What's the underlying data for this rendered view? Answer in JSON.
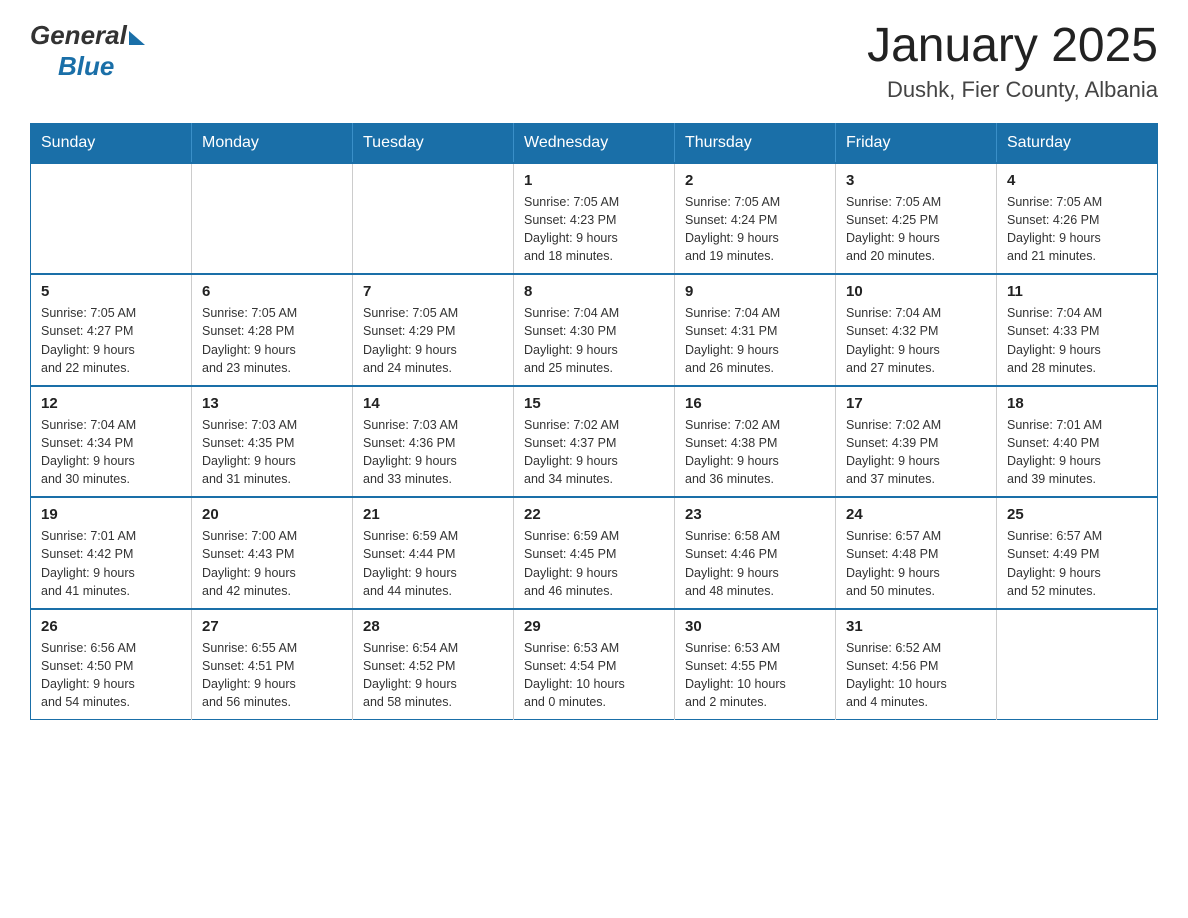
{
  "header": {
    "title": "January 2025",
    "location": "Dushk, Fier County, Albania",
    "logo_general": "General",
    "logo_blue": "Blue"
  },
  "calendar": {
    "days_of_week": [
      "Sunday",
      "Monday",
      "Tuesday",
      "Wednesday",
      "Thursday",
      "Friday",
      "Saturday"
    ],
    "weeks": [
      [
        {
          "day": "",
          "info": ""
        },
        {
          "day": "",
          "info": ""
        },
        {
          "day": "",
          "info": ""
        },
        {
          "day": "1",
          "info": "Sunrise: 7:05 AM\nSunset: 4:23 PM\nDaylight: 9 hours\nand 18 minutes."
        },
        {
          "day": "2",
          "info": "Sunrise: 7:05 AM\nSunset: 4:24 PM\nDaylight: 9 hours\nand 19 minutes."
        },
        {
          "day": "3",
          "info": "Sunrise: 7:05 AM\nSunset: 4:25 PM\nDaylight: 9 hours\nand 20 minutes."
        },
        {
          "day": "4",
          "info": "Sunrise: 7:05 AM\nSunset: 4:26 PM\nDaylight: 9 hours\nand 21 minutes."
        }
      ],
      [
        {
          "day": "5",
          "info": "Sunrise: 7:05 AM\nSunset: 4:27 PM\nDaylight: 9 hours\nand 22 minutes."
        },
        {
          "day": "6",
          "info": "Sunrise: 7:05 AM\nSunset: 4:28 PM\nDaylight: 9 hours\nand 23 minutes."
        },
        {
          "day": "7",
          "info": "Sunrise: 7:05 AM\nSunset: 4:29 PM\nDaylight: 9 hours\nand 24 minutes."
        },
        {
          "day": "8",
          "info": "Sunrise: 7:04 AM\nSunset: 4:30 PM\nDaylight: 9 hours\nand 25 minutes."
        },
        {
          "day": "9",
          "info": "Sunrise: 7:04 AM\nSunset: 4:31 PM\nDaylight: 9 hours\nand 26 minutes."
        },
        {
          "day": "10",
          "info": "Sunrise: 7:04 AM\nSunset: 4:32 PM\nDaylight: 9 hours\nand 27 minutes."
        },
        {
          "day": "11",
          "info": "Sunrise: 7:04 AM\nSunset: 4:33 PM\nDaylight: 9 hours\nand 28 minutes."
        }
      ],
      [
        {
          "day": "12",
          "info": "Sunrise: 7:04 AM\nSunset: 4:34 PM\nDaylight: 9 hours\nand 30 minutes."
        },
        {
          "day": "13",
          "info": "Sunrise: 7:03 AM\nSunset: 4:35 PM\nDaylight: 9 hours\nand 31 minutes."
        },
        {
          "day": "14",
          "info": "Sunrise: 7:03 AM\nSunset: 4:36 PM\nDaylight: 9 hours\nand 33 minutes."
        },
        {
          "day": "15",
          "info": "Sunrise: 7:02 AM\nSunset: 4:37 PM\nDaylight: 9 hours\nand 34 minutes."
        },
        {
          "day": "16",
          "info": "Sunrise: 7:02 AM\nSunset: 4:38 PM\nDaylight: 9 hours\nand 36 minutes."
        },
        {
          "day": "17",
          "info": "Sunrise: 7:02 AM\nSunset: 4:39 PM\nDaylight: 9 hours\nand 37 minutes."
        },
        {
          "day": "18",
          "info": "Sunrise: 7:01 AM\nSunset: 4:40 PM\nDaylight: 9 hours\nand 39 minutes."
        }
      ],
      [
        {
          "day": "19",
          "info": "Sunrise: 7:01 AM\nSunset: 4:42 PM\nDaylight: 9 hours\nand 41 minutes."
        },
        {
          "day": "20",
          "info": "Sunrise: 7:00 AM\nSunset: 4:43 PM\nDaylight: 9 hours\nand 42 minutes."
        },
        {
          "day": "21",
          "info": "Sunrise: 6:59 AM\nSunset: 4:44 PM\nDaylight: 9 hours\nand 44 minutes."
        },
        {
          "day": "22",
          "info": "Sunrise: 6:59 AM\nSunset: 4:45 PM\nDaylight: 9 hours\nand 46 minutes."
        },
        {
          "day": "23",
          "info": "Sunrise: 6:58 AM\nSunset: 4:46 PM\nDaylight: 9 hours\nand 48 minutes."
        },
        {
          "day": "24",
          "info": "Sunrise: 6:57 AM\nSunset: 4:48 PM\nDaylight: 9 hours\nand 50 minutes."
        },
        {
          "day": "25",
          "info": "Sunrise: 6:57 AM\nSunset: 4:49 PM\nDaylight: 9 hours\nand 52 minutes."
        }
      ],
      [
        {
          "day": "26",
          "info": "Sunrise: 6:56 AM\nSunset: 4:50 PM\nDaylight: 9 hours\nand 54 minutes."
        },
        {
          "day": "27",
          "info": "Sunrise: 6:55 AM\nSunset: 4:51 PM\nDaylight: 9 hours\nand 56 minutes."
        },
        {
          "day": "28",
          "info": "Sunrise: 6:54 AM\nSunset: 4:52 PM\nDaylight: 9 hours\nand 58 minutes."
        },
        {
          "day": "29",
          "info": "Sunrise: 6:53 AM\nSunset: 4:54 PM\nDaylight: 10 hours\nand 0 minutes."
        },
        {
          "day": "30",
          "info": "Sunrise: 6:53 AM\nSunset: 4:55 PM\nDaylight: 10 hours\nand 2 minutes."
        },
        {
          "day": "31",
          "info": "Sunrise: 6:52 AM\nSunset: 4:56 PM\nDaylight: 10 hours\nand 4 minutes."
        },
        {
          "day": "",
          "info": ""
        }
      ]
    ]
  }
}
